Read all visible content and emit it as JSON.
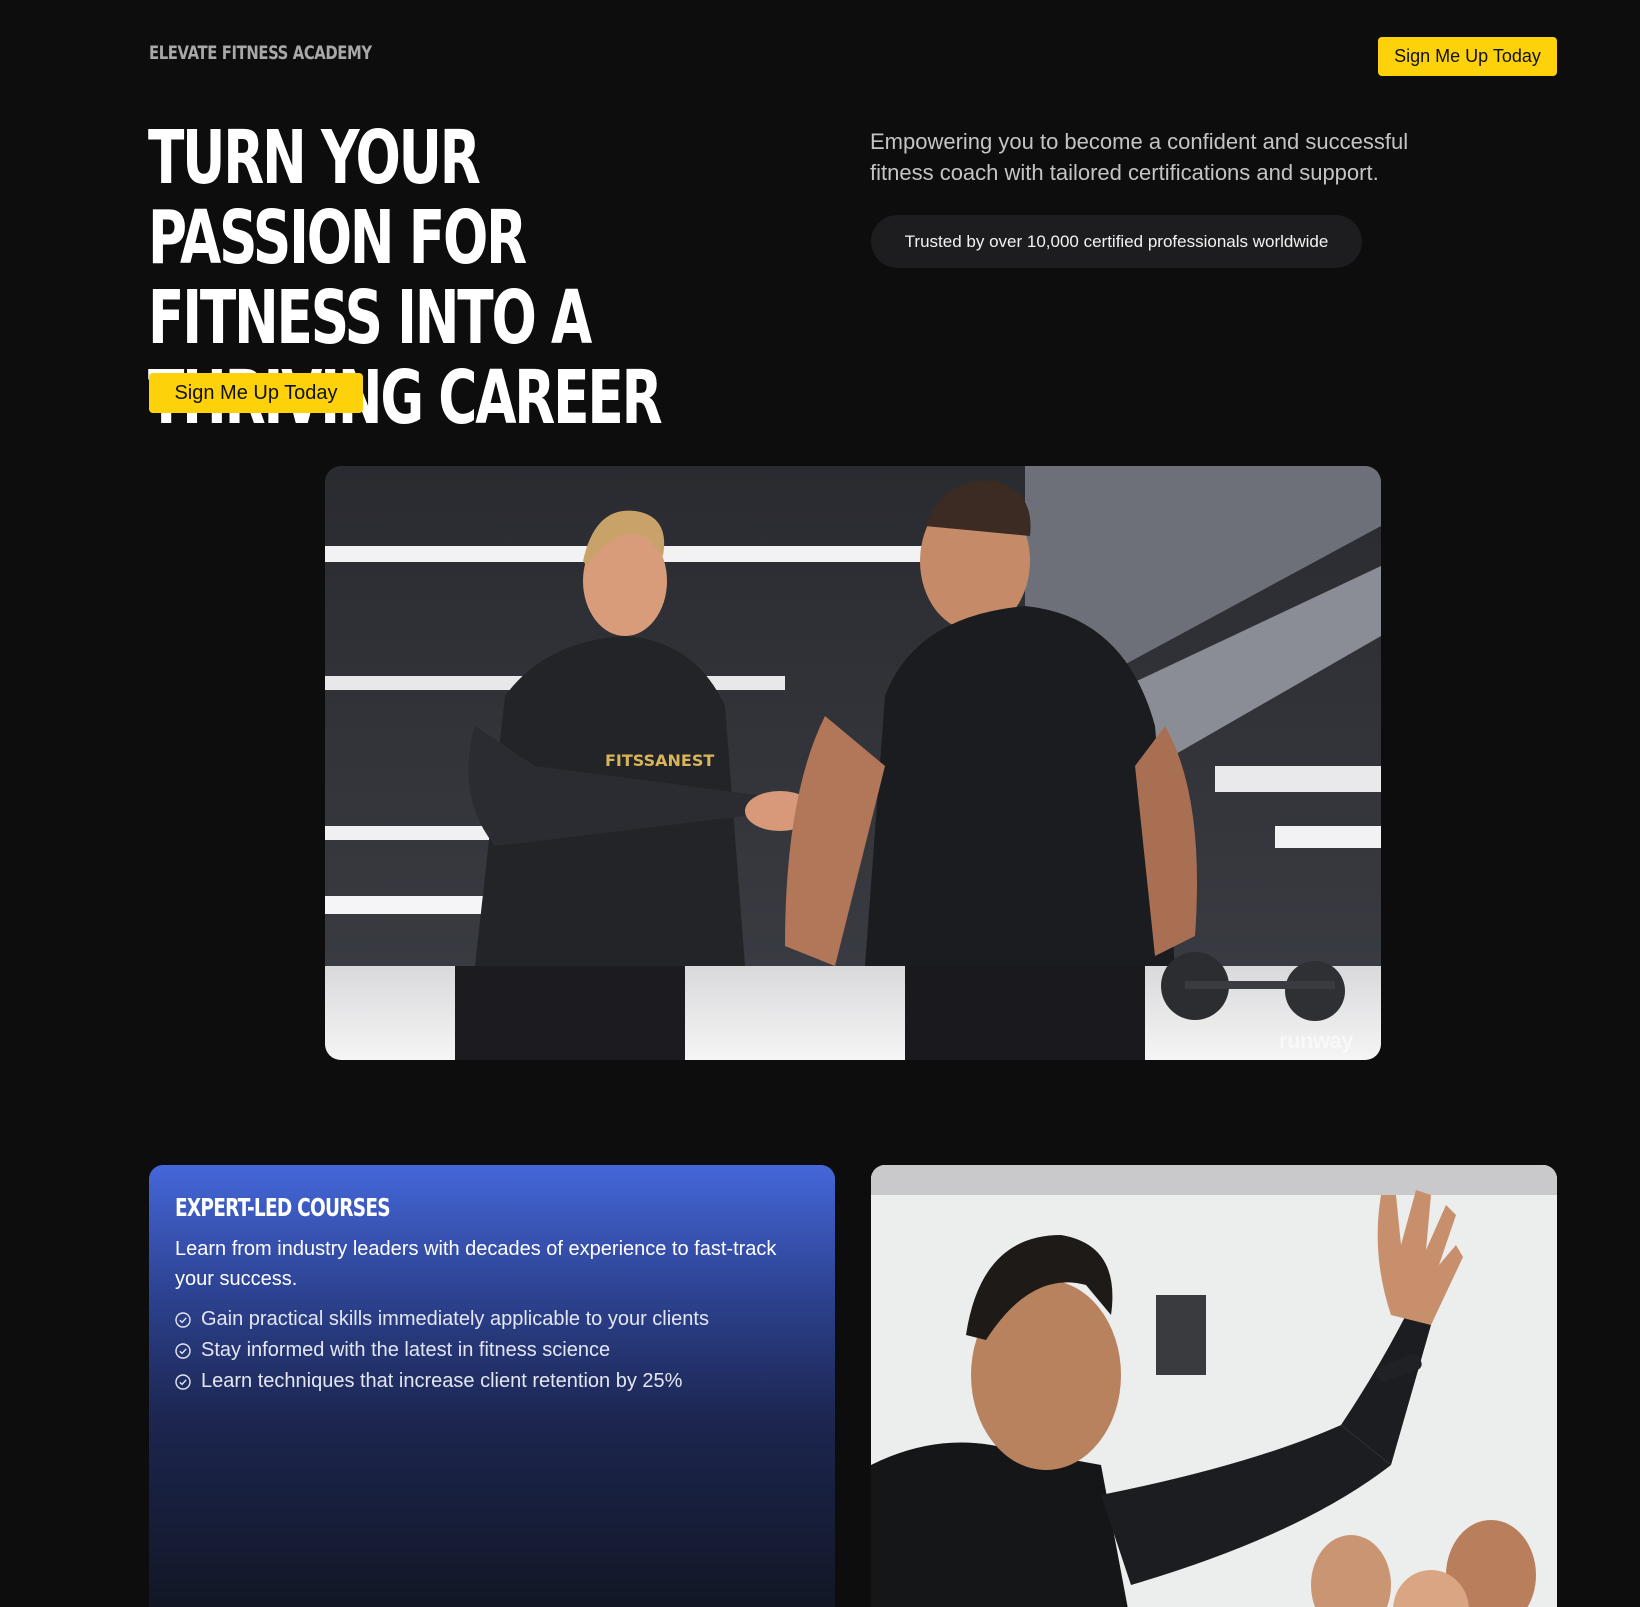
{
  "header": {
    "brand": "ELEVATE FITNESS ACADEMY",
    "cta_label": "Sign Me Up Today"
  },
  "hero": {
    "title": "TURN YOUR PASSION FOR FITNESS INTO A THRIVING CAREER",
    "description": "Empowering you to become a confident and successful fitness coach with tailored certifications and support.",
    "trust_badge": "Trusted by over 10,000 certified professionals worldwide",
    "cta_label": "Sign Me Up Today",
    "image_alt": "Fitness coach instructing a client in a gym",
    "watermark": "runway"
  },
  "features": {
    "title": "EXPERT-LED COURSES",
    "description": "Learn from industry leaders with decades of experience to fast-track your success.",
    "items": [
      {
        "label": "Gain practical skills immediately applicable to your clients",
        "icon": "check-circle-icon"
      },
      {
        "label": "Stay informed with the latest in fitness science",
        "icon": "check-circle-icon"
      },
      {
        "label": "Learn techniques that increase client retention by 25%",
        "icon": "check-circle-icon"
      }
    ],
    "image_alt": "Instructor raising his hand in front of a class"
  },
  "colors": {
    "background": "#0d0d0d",
    "accent": "#fdd20b",
    "card_blue": "#4467d9"
  }
}
